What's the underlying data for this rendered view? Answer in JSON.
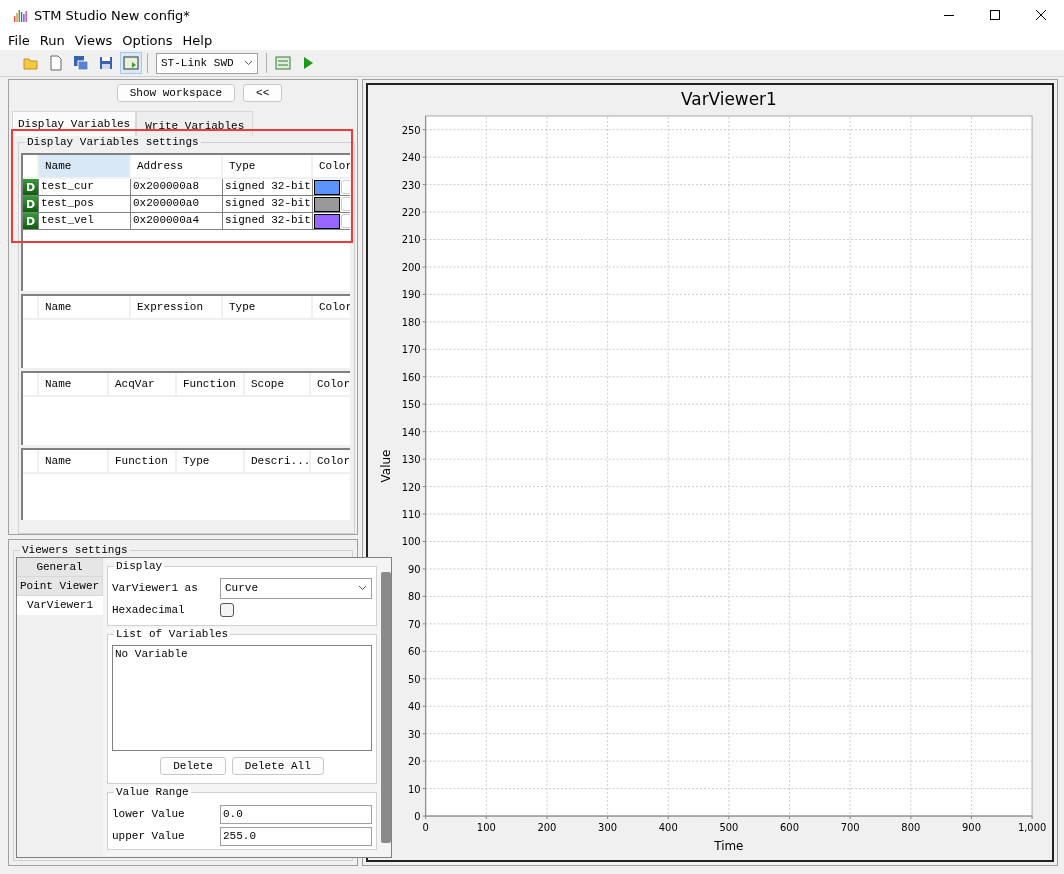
{
  "window": {
    "title": "STM Studio New config*"
  },
  "menu": [
    "File",
    "Run",
    "Views",
    "Options",
    "Help"
  ],
  "toolbar": {
    "connection": "ST-Link SWD"
  },
  "workspace_buttons": [
    "Show workspace",
    "<<"
  ],
  "tabs": [
    {
      "label": "Display Variables",
      "selected": true
    },
    {
      "label": "Write Variables",
      "selected": false
    }
  ],
  "display_settings": {
    "title": "Display Variables settings",
    "tables": [
      {
        "columns": [
          {
            "label": "Name",
            "selected": true
          },
          {
            "label": "Address",
            "selected": false
          },
          {
            "label": "Type",
            "selected": false
          },
          {
            "label": "Color",
            "selected": false
          }
        ],
        "rows": [
          {
            "badge": "D",
            "name": "test_cur",
            "address": "0x200000a8",
            "type": "signed 32-bit",
            "color": "#5b94fb"
          },
          {
            "badge": "D",
            "name": "test_pos",
            "address": "0x200000a0",
            "type": "signed 32-bit",
            "color": "#999999"
          },
          {
            "badge": "D",
            "name": "test_vel",
            "address": "0x200000a4",
            "type": "signed 32-bit",
            "color": "#9966ff"
          }
        ]
      },
      {
        "columns": [
          {
            "label": "Name",
            "selected": false
          },
          {
            "label": "Expression",
            "selected": false
          },
          {
            "label": "Type",
            "selected": false
          },
          {
            "label": "Color",
            "selected": false
          }
        ]
      },
      {
        "columns": [
          {
            "label": "Name",
            "selected": false
          },
          {
            "label": "AcqVar",
            "selected": false
          },
          {
            "label": "Function",
            "selected": false
          },
          {
            "label": "Scope",
            "selected": false
          },
          {
            "label": "Color",
            "selected": false
          }
        ]
      },
      {
        "columns": [
          {
            "label": "Name",
            "selected": false
          },
          {
            "label": "Function",
            "selected": false
          },
          {
            "label": "Type",
            "selected": false
          },
          {
            "label": "Descri...",
            "selected": false
          },
          {
            "label": "Color",
            "selected": false
          }
        ]
      }
    ]
  },
  "viewers_settings": {
    "title": "Viewers settings",
    "tabs": [
      {
        "label": "General",
        "selected": false
      },
      {
        "label": "Point Viewer",
        "selected": false
      },
      {
        "label": "VarViewer1",
        "selected": true
      }
    ],
    "display": {
      "title": "Display",
      "as_label": "VarViewer1 as",
      "as_value": "Curve",
      "hex_label": "Hexadecimal",
      "hex_checked": false
    },
    "variables": {
      "title": "List of Variables",
      "items": [
        "No Variable"
      ],
      "buttons": [
        "Delete",
        "Delete All"
      ]
    },
    "range": {
      "title": "Value Range",
      "lower_label": "lower Value",
      "lower_value": "0.0",
      "upper_label": "upper Value",
      "upper_value": "255.0"
    }
  },
  "chart": {
    "chart_data": {
      "type": "line",
      "grid": true,
      "title": "VarViewer1",
      "xlabel": "Time",
      "ylabel": "Value",
      "xlim": [
        0,
        1000
      ],
      "ylim": [
        0,
        255
      ],
      "xticks": [
        0,
        100,
        200,
        300,
        400,
        500,
        600,
        700,
        800,
        900,
        {
          "value": 1000,
          "label": "1,000"
        }
      ],
      "yticks": [
        0,
        10,
        20,
        30,
        40,
        50,
        60,
        70,
        80,
        90,
        100,
        110,
        120,
        130,
        140,
        150,
        160,
        170,
        180,
        190,
        200,
        210,
        220,
        230,
        240,
        250
      ]
    }
  }
}
